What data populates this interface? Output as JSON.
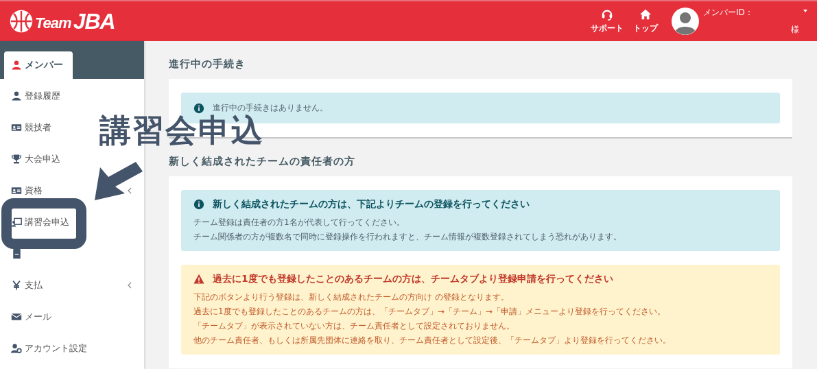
{
  "header": {
    "logo": {
      "word": "Team",
      "mark": "JBA"
    },
    "nav": [
      {
        "label": "サポート"
      },
      {
        "label": "トップ"
      }
    ],
    "user": {
      "id_label": "メンバーID：",
      "suffix": "様"
    }
  },
  "sidebar": {
    "tab": {
      "label": "メンバー",
      "selected": true
    },
    "items": [
      {
        "kind": "link",
        "label": "登録履歴",
        "expandable": false
      },
      {
        "kind": "link",
        "label": "競技者",
        "expandable": false
      },
      {
        "kind": "link",
        "label": "大会申込",
        "expandable": false
      },
      {
        "kind": "link",
        "label": "資格",
        "expandable": true
      },
      {
        "kind": "link",
        "label": "講習会申込",
        "expandable": false
      },
      {
        "kind": "covered"
      },
      {
        "kind": "link",
        "label": "支払",
        "expandable": true
      },
      {
        "kind": "link",
        "label": "メール",
        "expandable": false
      },
      {
        "kind": "link",
        "label": "アカウント設定",
        "expandable": false
      }
    ]
  },
  "sections": [
    {
      "title": "進行中の手続き",
      "alerts": [
        {
          "kind": "info",
          "lines": [
            "進行中の手続きはありません。"
          ]
        }
      ]
    },
    {
      "title": "新しく結成されたチームの責任者の方",
      "alerts": [
        {
          "kind": "info",
          "title": "新しく結成されたチームの方は、下記よりチームの登録を行ってください",
          "lines": [
            "チーム登録は責任者の方1名が代表して行ってください。",
            "チーム関係者の方が複数名で同時に登録操作を行われますと、チーム情報が複数登録されてしまう恐れがあります。"
          ]
        },
        {
          "kind": "warning",
          "title": "過去に1度でも登録したことのあるチームの方は、チームタブより登録申請を行ってください",
          "lines": [
            "下記のボタンより行う登録は、新しく結成されたチームの方向け の登録となります。",
            "過去に1度でも登録したことのあるチームの方は、「チームタブ」→「チーム」→「申請」メニューより登録を行ってください。",
            "「チームタブ」が表示されていない方は、チーム責任者として設定されておりません。",
            "他のチーム責任者、もしくは所属先団体に連絡を取り、チーム責任者として設定後、「チームタブ」より登録を行ってください。"
          ]
        }
      ]
    }
  ],
  "annotation": {
    "title": "講習会申込"
  }
}
